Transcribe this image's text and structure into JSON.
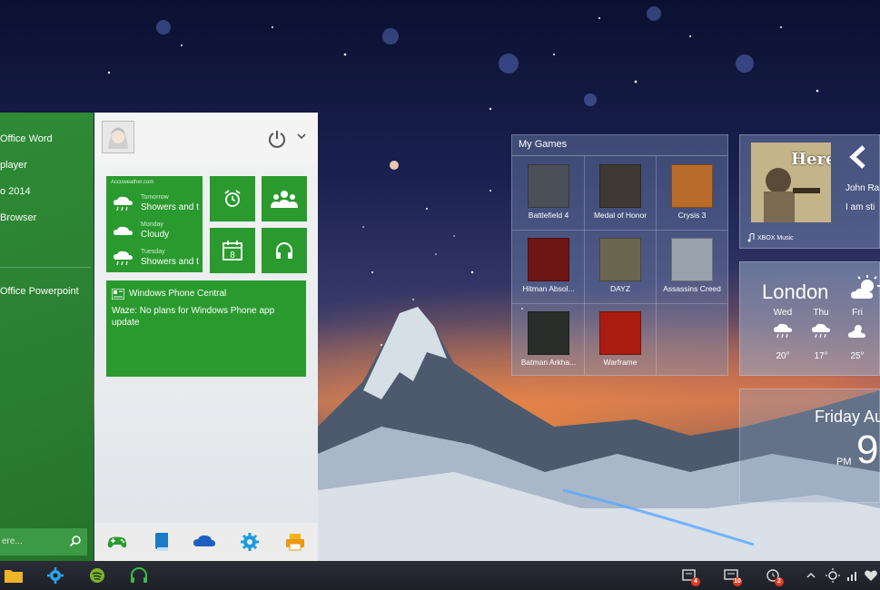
{
  "start_menu": {
    "apps": [
      {
        "label": "Office Word"
      },
      {
        "label": "player"
      },
      {
        "label": "o 2014"
      },
      {
        "label": "Browser"
      },
      {
        "label": "Office Powerpoint"
      }
    ],
    "search_placeholder": "ere..."
  },
  "weather_tile": {
    "source": "Accuweather.com",
    "days": [
      {
        "day": "Tomorrow",
        "cond": "Showers and t"
      },
      {
        "day": "Monday",
        "cond": "Cloudy"
      },
      {
        "day": "Tuesday",
        "cond": "Showers and t"
      }
    ]
  },
  "live_tiles": {
    "phone_title": "Windows Phone Central",
    "phone_body": "Waze: No plans for Windows Phone app update",
    "calendar_day": "8"
  },
  "games": {
    "title": "My Games",
    "items": [
      {
        "label": "Battlefield 4",
        "color": "#4a4f58"
      },
      {
        "label": "Medal of Honor",
        "color": "#3e3a33"
      },
      {
        "label": "Crysis 3",
        "color": "#b96b2a"
      },
      {
        "label": "Hitman Absol...",
        "color": "#6c1616"
      },
      {
        "label": "DAYZ",
        "color": "#6b6650"
      },
      {
        "label": "Assassins Creed",
        "color": "#9aa3ad"
      },
      {
        "label": "Batman Arkha...",
        "color": "#2a2e2a"
      },
      {
        "label": "Warframe",
        "color": "#a81c12"
      }
    ]
  },
  "music": {
    "album_title": "Here",
    "artist": "John Ra",
    "track": "I am sti",
    "source": "XBOX Music"
  },
  "weather_widget": {
    "city": "London",
    "forecast": [
      {
        "day": "Wed",
        "temp": "20°"
      },
      {
        "day": "Thu",
        "temp": "17°"
      },
      {
        "day": "Fri",
        "temp": "25°"
      }
    ]
  },
  "clock": {
    "date": "Friday Au",
    "ampm": "PM",
    "time": "9"
  },
  "taskbar": {
    "tray_badges": [
      "4",
      "10",
      "2"
    ]
  },
  "colors": {
    "accent_green": "#2a9a2f",
    "start_left_green": "#2e8b35",
    "badge_red": "#e03b1f"
  }
}
